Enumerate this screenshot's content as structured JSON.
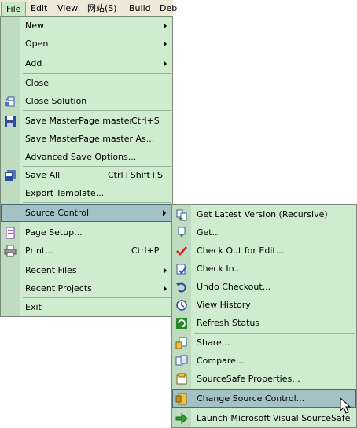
{
  "menubar": {
    "items": [
      {
        "label": "File"
      },
      {
        "label": "Edit"
      },
      {
        "label": "View"
      },
      {
        "label": "网站(S)"
      },
      {
        "label": "Build"
      },
      {
        "label": "Deb"
      }
    ]
  },
  "file_menu": {
    "new": {
      "label": "New"
    },
    "open": {
      "label": "Open"
    },
    "add": {
      "label": "Add"
    },
    "close": {
      "label": "Close"
    },
    "close_solution": {
      "label": "Close Solution"
    },
    "save_master": {
      "label": "Save MasterPage.master",
      "shortcut": "Ctrl+S"
    },
    "save_master_as": {
      "label": "Save MasterPage.master As..."
    },
    "advanced_save": {
      "label": "Advanced Save Options..."
    },
    "save_all": {
      "label": "Save All",
      "shortcut": "Ctrl+Shift+S"
    },
    "export_template": {
      "label": "Export Template..."
    },
    "source_control": {
      "label": "Source Control"
    },
    "page_setup": {
      "label": "Page Setup..."
    },
    "print": {
      "label": "Print...",
      "shortcut": "Ctrl+P"
    },
    "recent_files": {
      "label": "Recent Files"
    },
    "recent_projects": {
      "label": "Recent Projects"
    },
    "exit": {
      "label": "Exit"
    }
  },
  "source_control_menu": {
    "get_latest": {
      "label": "Get Latest Version (Recursive)"
    },
    "get": {
      "label": "Get..."
    },
    "check_out": {
      "label": "Check Out for Edit..."
    },
    "check_in": {
      "label": "Check In..."
    },
    "undo_checkout": {
      "label": "Undo Checkout..."
    },
    "view_history": {
      "label": "View History"
    },
    "refresh_status": {
      "label": "Refresh Status"
    },
    "share": {
      "label": "Share..."
    },
    "compare": {
      "label": "Compare..."
    },
    "sourcesafe_properties": {
      "label": "SourceSafe Properties..."
    },
    "change_source_control": {
      "label": "Change Source Control..."
    },
    "launch_sourcesafe": {
      "label": "Launch Microsoft Visual SourceSafe"
    }
  }
}
